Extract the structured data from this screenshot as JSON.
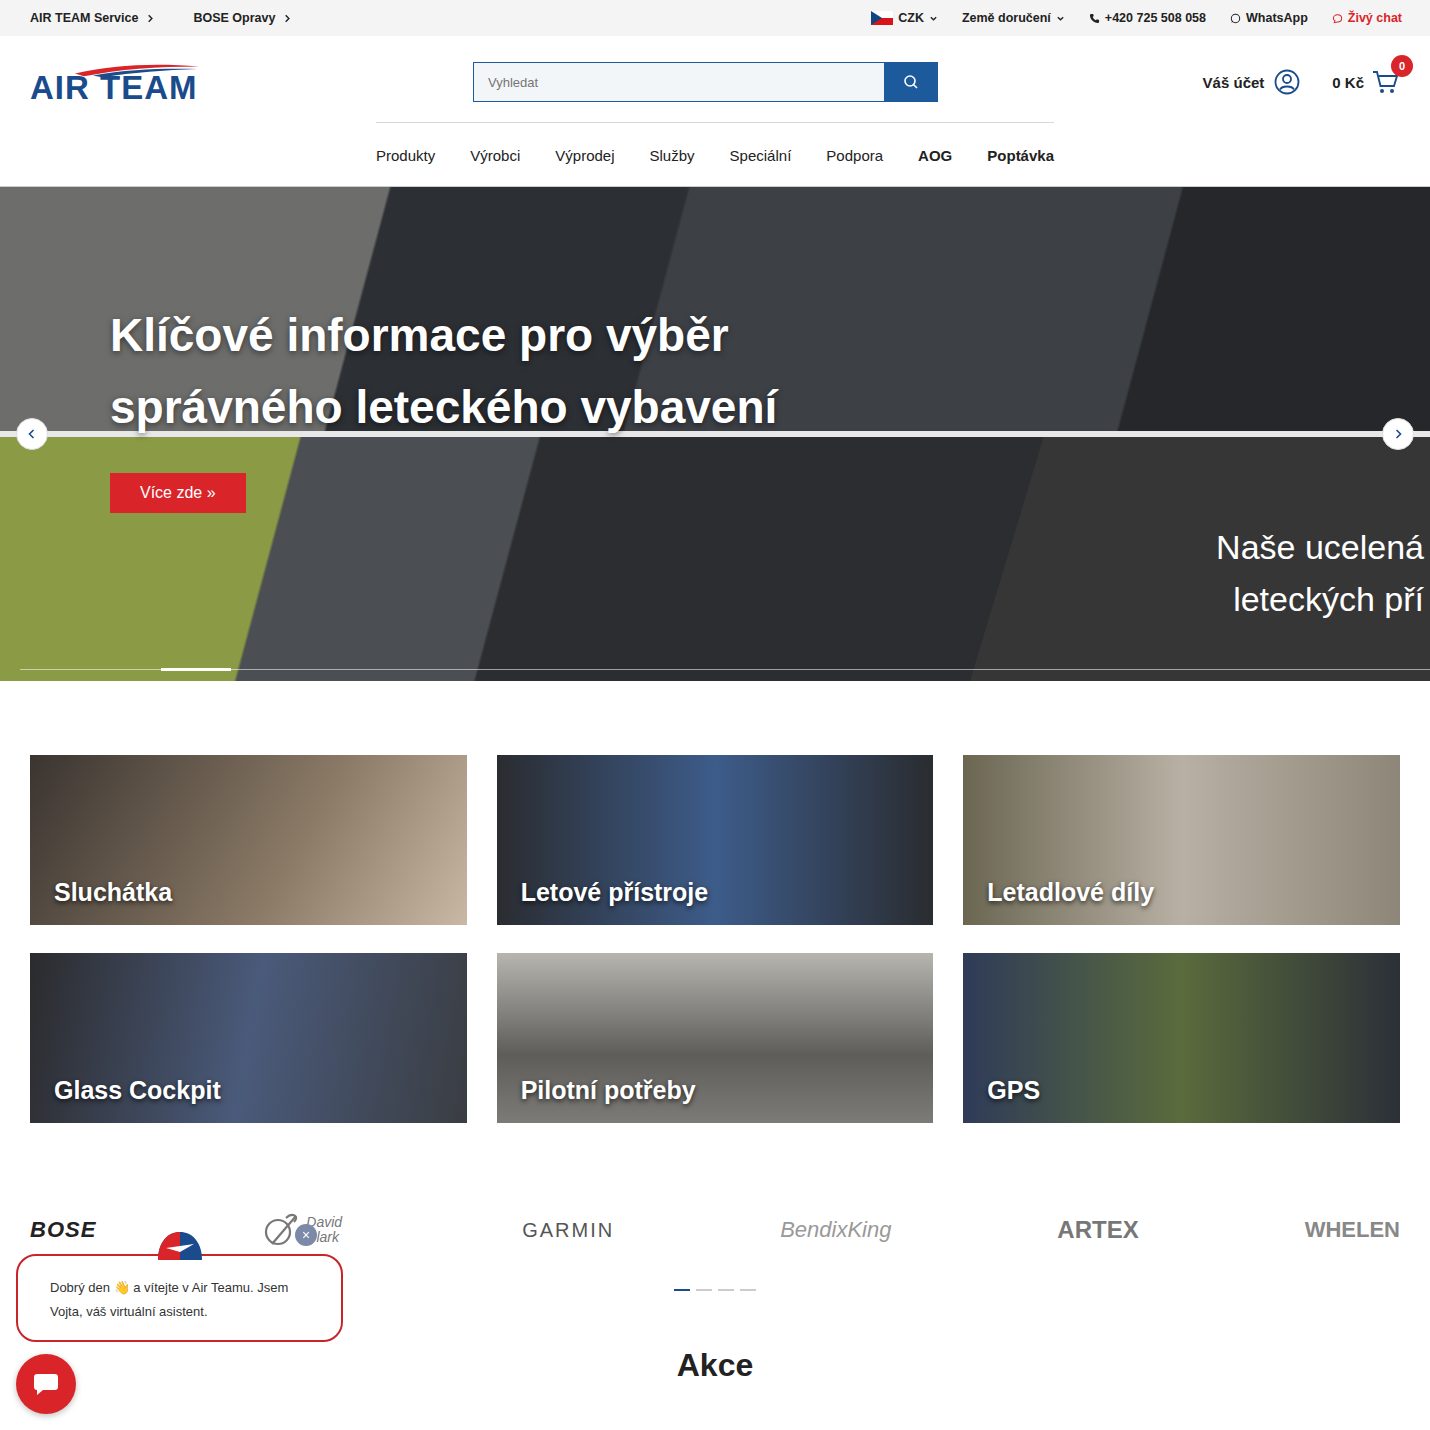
{
  "top_bar": {
    "links": [
      {
        "label": "AIR TEAM Service"
      },
      {
        "label": "BOSE Opravy"
      }
    ],
    "currency": "CZK",
    "delivery": "Země doručení",
    "phone": "+420 725 508 058",
    "whatsapp": "WhatsApp",
    "live_chat": "Živý chat"
  },
  "header": {
    "logo": "AIR TEAM",
    "search": {
      "placeholder": "Vyhledat"
    },
    "account": "Váš účet",
    "cart": {
      "total": "0 Kč",
      "count": "0"
    }
  },
  "nav": [
    {
      "label": "Produkty",
      "bold": false
    },
    {
      "label": "Výrobci",
      "bold": false
    },
    {
      "label": "Výprodej",
      "bold": false
    },
    {
      "label": "Služby",
      "bold": false
    },
    {
      "label": "Speciální",
      "bold": false
    },
    {
      "label": "Podpora",
      "bold": false
    },
    {
      "label": "AOG",
      "bold": true
    },
    {
      "label": "Poptávka",
      "bold": true
    }
  ],
  "hero": {
    "title": "Klíčové informace pro výběr správného leteckého vybavení",
    "button": "Více zde »",
    "next_slide_lines": [
      "Naše ucelená",
      "leteckých pří"
    ],
    "slides": [
      {
        "selected": false
      },
      {
        "selected": true
      },
      {
        "selected": false
      },
      {
        "selected": false
      },
      {
        "selected": false
      },
      {
        "selected": false
      },
      {
        "selected": false
      },
      {
        "selected": false
      },
      {
        "selected": false
      },
      {
        "selected": false
      }
    ]
  },
  "categories": [
    {
      "label": "Sluchátka"
    },
    {
      "label": "Letové přístroje"
    },
    {
      "label": "Letadlové díly"
    },
    {
      "label": "Glass Cockpit"
    },
    {
      "label": "Pilotní potřeby"
    },
    {
      "label": "GPS"
    }
  ],
  "brands": {
    "items": [
      {
        "name": "BOSE",
        "kind": "bose"
      },
      {
        "name": "David Clark",
        "kind": "clark"
      },
      {
        "name": "GARMIN",
        "kind": "garmin"
      },
      {
        "name": "BendixKing",
        "kind": "bendix"
      },
      {
        "name": "ARTEX",
        "kind": "artex"
      },
      {
        "name": "WHELEN",
        "kind": "whelen"
      }
    ],
    "dots": [
      {
        "selected": true
      },
      {
        "selected": false
      },
      {
        "selected": false
      },
      {
        "selected": false
      }
    ]
  },
  "section_title": "Akce",
  "chat": {
    "message": "Dobrý den 👋 a vítejte v Air Teamu. Jsem Vojta, váš virtuální asistent.",
    "close": "×"
  }
}
